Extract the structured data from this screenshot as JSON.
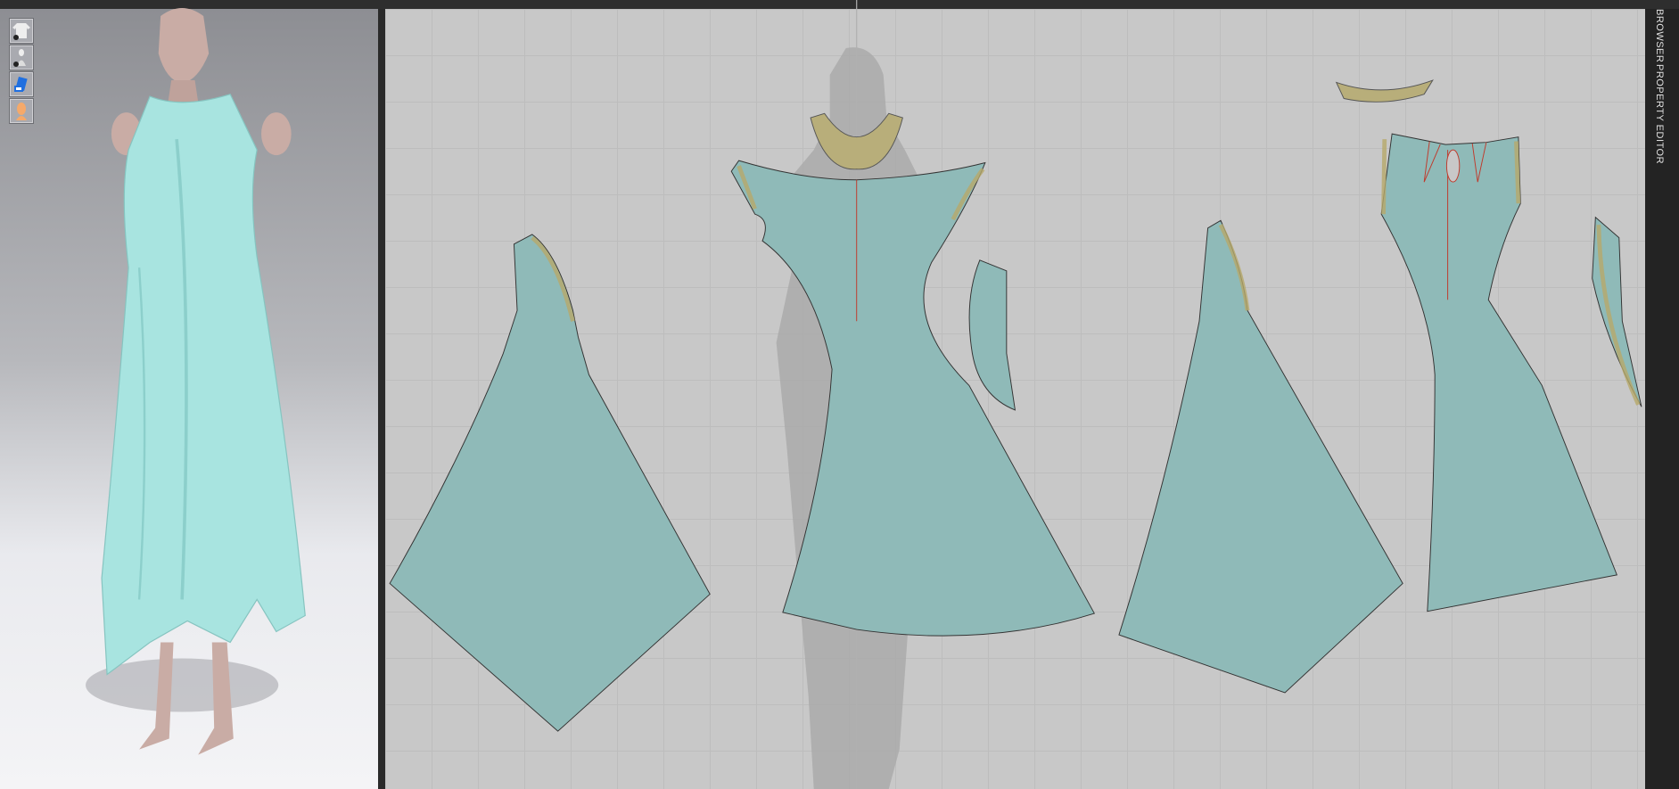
{
  "sidebar": {
    "tabs": [
      {
        "label": "BROWSER"
      },
      {
        "label": "PROPERTY EDITOR"
      }
    ]
  },
  "tools3d": [
    {
      "icon": "garment-visibility-icon"
    },
    {
      "icon": "avatar-visibility-icon"
    },
    {
      "icon": "texture-icon"
    },
    {
      "icon": "skin-icon"
    }
  ],
  "colors": {
    "fabric": "#8fbab8",
    "trim": "#b8ae7a",
    "dress3d": "#a8e4e0",
    "skin": "#c9aca5"
  }
}
